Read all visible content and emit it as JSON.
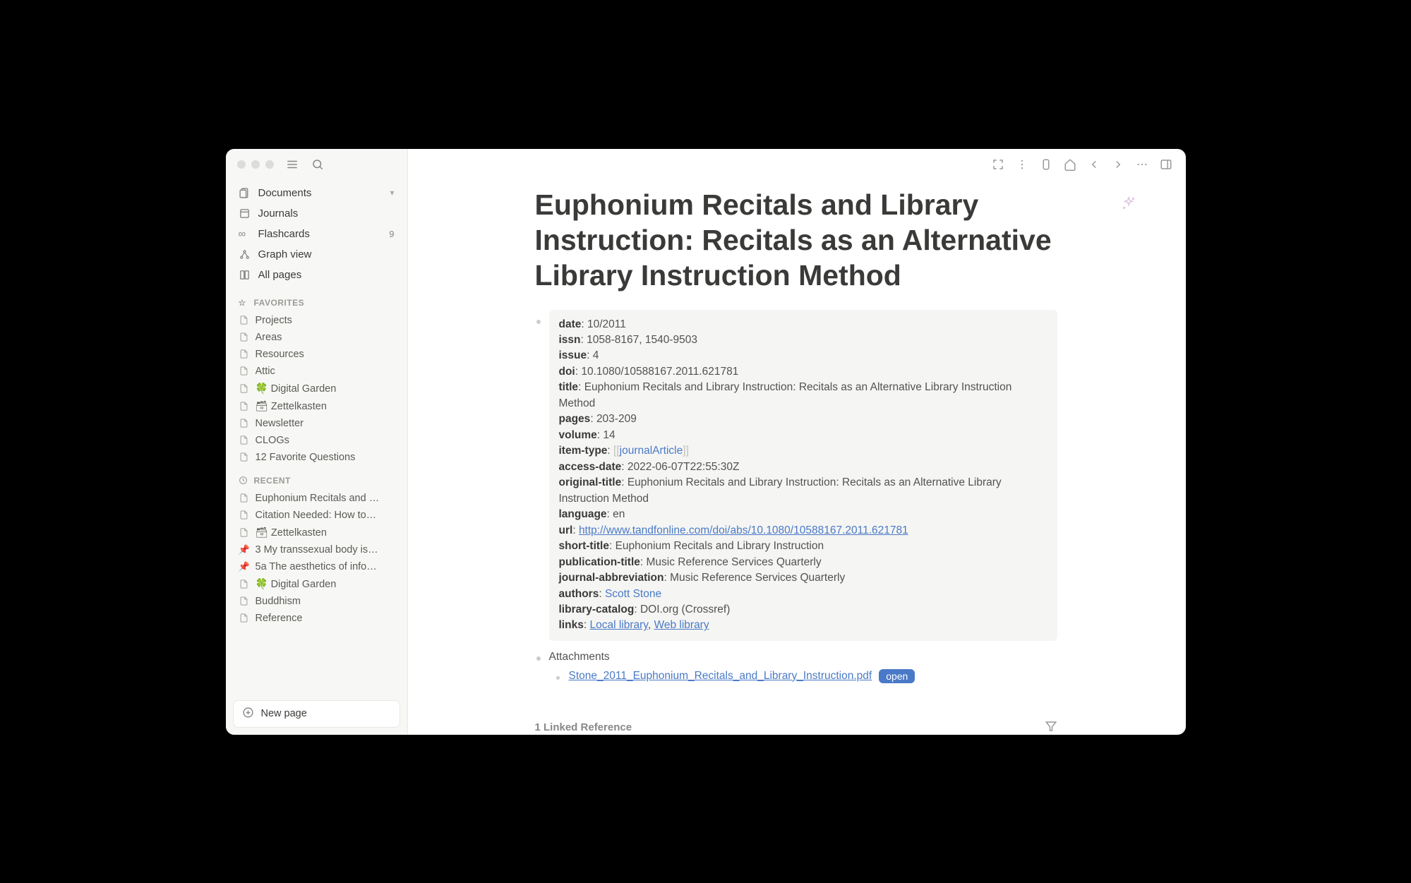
{
  "sidebar": {
    "nav": [
      {
        "icon": "documents",
        "label": "Documents",
        "chevron": true
      },
      {
        "icon": "journals",
        "label": "Journals"
      },
      {
        "icon": "flashcards",
        "label": "Flashcards",
        "badge": "9"
      },
      {
        "icon": "graph",
        "label": "Graph view"
      },
      {
        "icon": "allpages",
        "label": "All pages"
      }
    ],
    "favorites_header": "FAVORITES",
    "favorites": [
      {
        "icon": "page",
        "label": "Projects"
      },
      {
        "icon": "page",
        "label": "Areas"
      },
      {
        "icon": "page",
        "label": "Resources"
      },
      {
        "icon": "page",
        "label": "Attic"
      },
      {
        "icon": "page",
        "label": "🍀 Digital Garden"
      },
      {
        "icon": "page",
        "label": "🗃 Zettelkasten"
      },
      {
        "icon": "page",
        "label": "Newsletter"
      },
      {
        "icon": "page",
        "label": "CLOGs"
      },
      {
        "icon": "page",
        "label": "12 Favorite Questions"
      }
    ],
    "recent_header": "RECENT",
    "recent": [
      {
        "icon": "page",
        "label": "Euphonium Recitals and …"
      },
      {
        "icon": "page",
        "label": "Citation Needed: How to…"
      },
      {
        "icon": "page",
        "label": "🗃 Zettelkasten"
      },
      {
        "icon": "pin",
        "label": "3 My transsexual body is…"
      },
      {
        "icon": "pin",
        "label": "5a The aesthetics of info…"
      },
      {
        "icon": "page",
        "label": "🍀 Digital Garden"
      },
      {
        "icon": "page",
        "label": "Buddhism"
      },
      {
        "icon": "page",
        "label": "Reference"
      }
    ],
    "new_page_label": "New page"
  },
  "page": {
    "title": "Euphonium Recitals and Library Instruction: Recitals as an Alternative Library Instruction Method",
    "meta": {
      "date": "10/2011",
      "issn": "1058-8167, 1540-9503",
      "issue": "4",
      "doi": "10.1080/10588167.2011.621781",
      "title_val": "Euphonium Recitals and Library Instruction: Recitals as an Alternative Library Instruction Method",
      "pages": "203-209",
      "volume": "14",
      "item_type": "journalArticle",
      "access_date": "2022-06-07T22:55:30Z",
      "original_title": "Euphonium Recitals and Library Instruction: Recitals as an Alternative Library Instruction Method",
      "language": "en",
      "url": "http://www.tandfonline.com/doi/abs/10.1080/10588167.2011.621781",
      "short_title": "Euphonium Recitals and Library Instruction",
      "publication_title": "Music Reference Services Quarterly",
      "journal_abbreviation": "Music Reference Services Quarterly",
      "author": "Scott Stone",
      "library_catalog": "DOI.org (Crossref)",
      "link_local": "Local library",
      "link_web": "Web library"
    },
    "labels": {
      "date": "date",
      "issn": "issn",
      "issue": "issue",
      "doi": "doi",
      "title": "title",
      "pages": "pages",
      "volume": "volume",
      "item_type": "item-type",
      "access_date": "access-date",
      "original_title": "original-title",
      "language": "language",
      "url": "url",
      "short_title": "short-title",
      "publication_title": "publication-title",
      "journal_abbreviation": "journal-abbreviation",
      "authors": "authors",
      "library_catalog": "library-catalog",
      "links": "links"
    },
    "attachments_label": "Attachments",
    "attachment_file": "Stone_2011_Euphonium_Recitals_and_Library_Instruction.pdf",
    "open_label": "open",
    "linked_refs": "1 Linked Reference"
  }
}
